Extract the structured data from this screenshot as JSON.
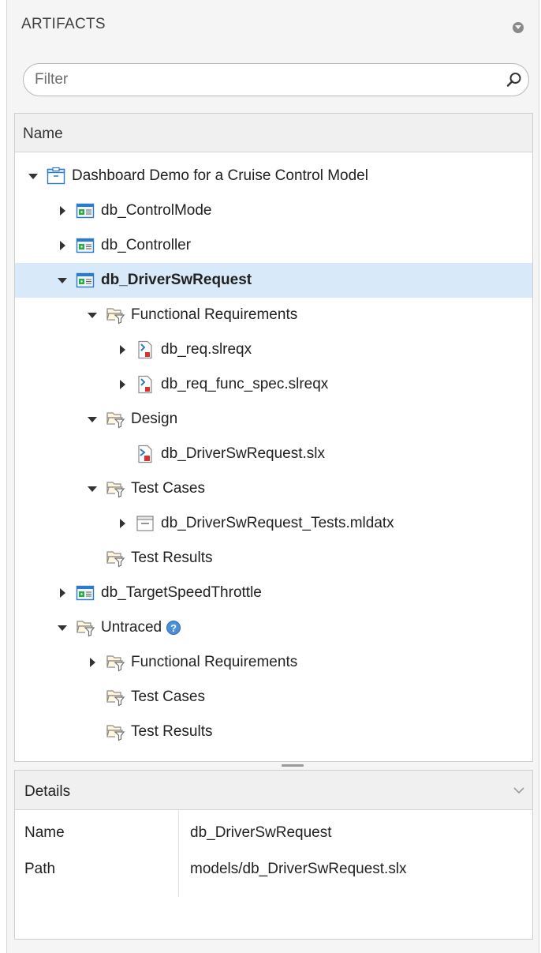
{
  "header": {
    "title": "ARTIFACTS"
  },
  "filter": {
    "placeholder": "Filter",
    "value": ""
  },
  "tree": {
    "column": "Name",
    "rows": [
      {
        "label": "Dashboard Demo for a Cruise Control Model",
        "icon": "project-icon"
      },
      {
        "label": "db_ControlMode",
        "icon": "model-icon"
      },
      {
        "label": "db_Controller",
        "icon": "model-icon"
      },
      {
        "label": "db_DriverSwRequest",
        "icon": "model-icon"
      },
      {
        "label": "Functional Requirements",
        "icon": "folder-filter-icon"
      },
      {
        "label": "db_req.slreqx",
        "icon": "requirement-file-icon"
      },
      {
        "label": "db_req_func_spec.slreqx",
        "icon": "requirement-file-icon"
      },
      {
        "label": "Design",
        "icon": "folder-filter-icon"
      },
      {
        "label": "db_DriverSwRequest.slx",
        "icon": "simulink-file-icon"
      },
      {
        "label": "Test Cases",
        "icon": "folder-filter-icon"
      },
      {
        "label": "db_DriverSwRequest_Tests.mldatx",
        "icon": "test-file-icon"
      },
      {
        "label": "Test Results",
        "icon": "folder-filter-icon"
      },
      {
        "label": "db_TargetSpeedThrottle",
        "icon": "model-icon"
      },
      {
        "label": "Untraced",
        "icon": "folder-filter-icon",
        "help": "?"
      },
      {
        "label": "Functional Requirements",
        "icon": "folder-filter-icon"
      },
      {
        "label": "Test Cases",
        "icon": "folder-filter-icon"
      },
      {
        "label": "Test Results",
        "icon": "folder-filter-icon"
      }
    ]
  },
  "details": {
    "title": "Details",
    "rows": [
      {
        "key": "Name",
        "value": "db_DriverSwRequest"
      },
      {
        "key": "Path",
        "value": "models/db_DriverSwRequest.slx"
      }
    ]
  },
  "colors": {
    "selection": "#d8eaf9",
    "accent": "#2d7ac9",
    "model_green": "#2eaa45",
    "req_red": "#d9342b"
  }
}
